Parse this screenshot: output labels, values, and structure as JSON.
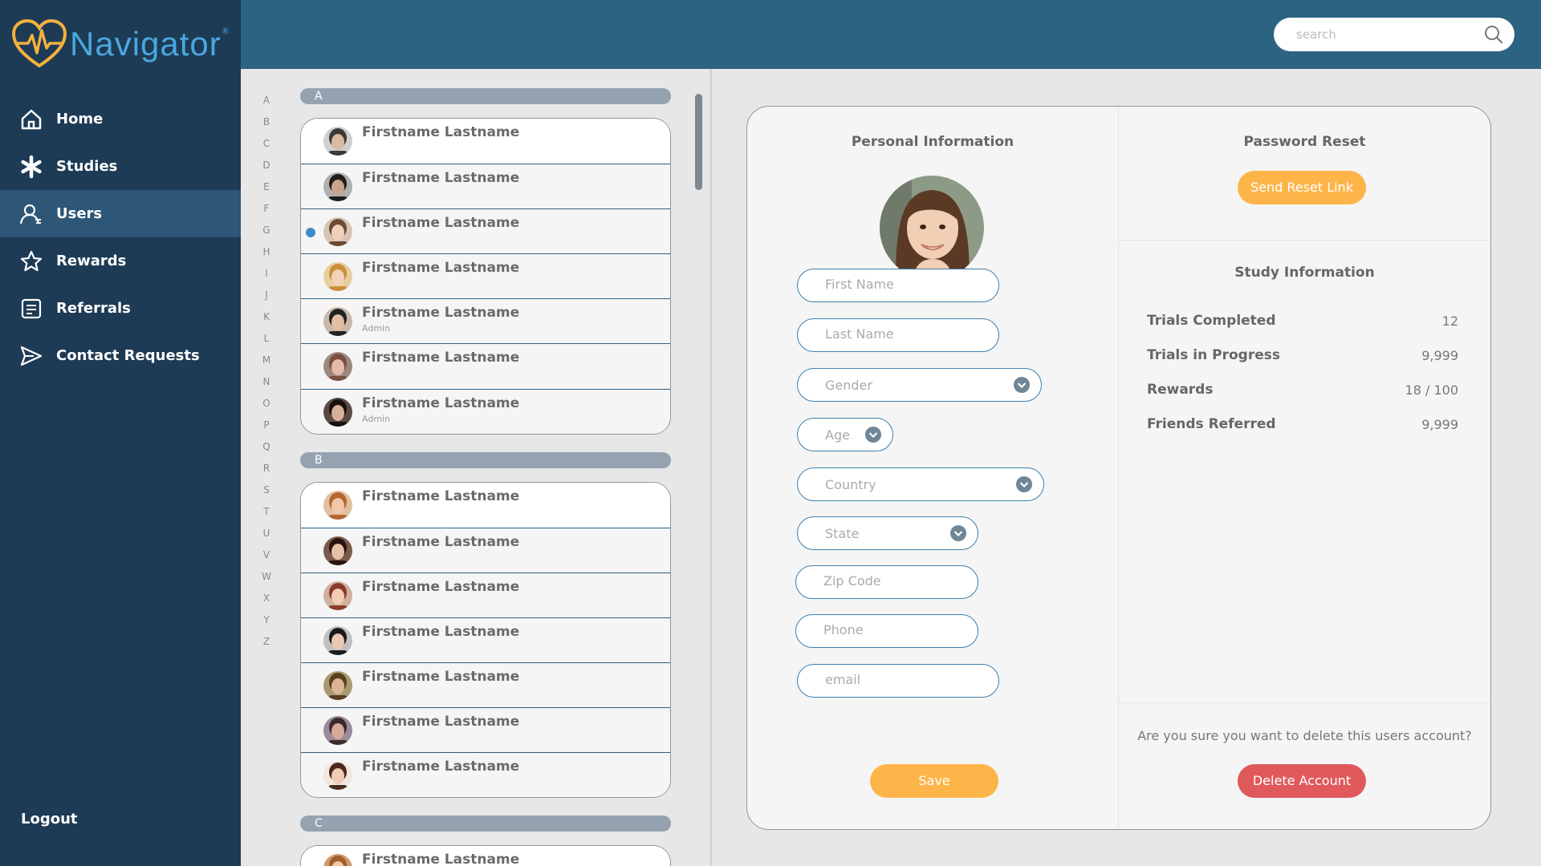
{
  "app": {
    "name": "Navigator",
    "reg": "®"
  },
  "nav": {
    "items": [
      {
        "label": "Home",
        "icon": "home-icon"
      },
      {
        "label": "Studies",
        "icon": "asterisk-icon"
      },
      {
        "label": "Users",
        "icon": "user-icon",
        "active": true
      },
      {
        "label": "Rewards",
        "icon": "star-icon"
      },
      {
        "label": "Referrals",
        "icon": "document-icon"
      },
      {
        "label": "Contact Requests",
        "icon": "send-icon"
      }
    ],
    "logout": "Logout"
  },
  "search": {
    "placeholder": "search"
  },
  "alphabet": [
    "A",
    "B",
    "C",
    "D",
    "E",
    "F",
    "G",
    "H",
    "I",
    "J",
    "K",
    "L",
    "M",
    "N",
    "O",
    "P",
    "Q",
    "R",
    "S",
    "T",
    "U",
    "V",
    "W",
    "X",
    "Y",
    "Z"
  ],
  "user_groups": [
    {
      "letter": "A",
      "users": [
        {
          "name": "Firstname Lastname",
          "role": ""
        },
        {
          "name": "Firstname Lastname",
          "role": ""
        },
        {
          "name": "Firstname Lastname",
          "role": "",
          "selected": true
        },
        {
          "name": "Firstname Lastname",
          "role": ""
        },
        {
          "name": "Firstname Lastname",
          "role": "Admin"
        },
        {
          "name": "Firstname Lastname",
          "role": ""
        },
        {
          "name": "Firstname Lastname",
          "role": "Admin"
        }
      ]
    },
    {
      "letter": "B",
      "users": [
        {
          "name": "Firstname Lastname",
          "role": ""
        },
        {
          "name": "Firstname Lastname",
          "role": ""
        },
        {
          "name": "Firstname Lastname",
          "role": ""
        },
        {
          "name": "Firstname Lastname",
          "role": ""
        },
        {
          "name": "Firstname Lastname",
          "role": ""
        },
        {
          "name": "Firstname Lastname",
          "role": ""
        },
        {
          "name": "Firstname Lastname",
          "role": ""
        }
      ]
    },
    {
      "letter": "C",
      "users": [
        {
          "name": "Firstname Lastname",
          "role": ""
        }
      ]
    }
  ],
  "personal": {
    "title": "Personal Information",
    "fields": {
      "first_name": "First Name",
      "last_name": "Last Name",
      "gender": "Gender",
      "age": "Age",
      "country": "Country",
      "state": "State",
      "zip": "Zip Code",
      "phone": "Phone",
      "email": "email"
    },
    "save": "Save"
  },
  "password": {
    "title": "Password Reset",
    "button": "Send Reset Link"
  },
  "study": {
    "title": "Study Information",
    "stats": [
      {
        "label": "Trials Completed",
        "value": "12"
      },
      {
        "label": "Trials in Progress",
        "value": "9,999"
      },
      {
        "label": "Rewards",
        "value": "18 / 100"
      },
      {
        "label": "Friends Referred",
        "value": "9,999"
      }
    ]
  },
  "delete": {
    "question": "Are you sure you want to delete this users account?",
    "button": "Delete Account"
  },
  "colors": {
    "sidebar": "#1d3b55",
    "topbar": "#2c6383",
    "accent": "#fdb54a",
    "danger": "#e05a5c",
    "field_border": "#3e7fac"
  }
}
